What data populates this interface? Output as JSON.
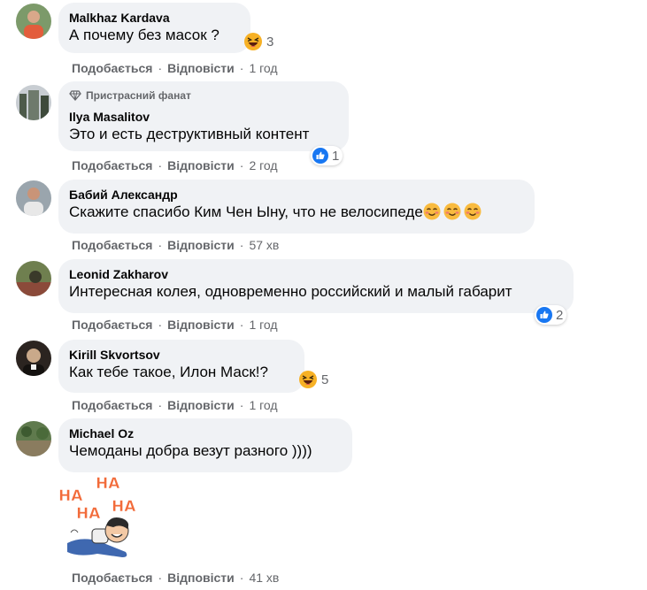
{
  "actions": {
    "like": "Подобається",
    "reply": "Відповісти"
  },
  "comments": [
    {
      "author": "Malkhaz Kardava",
      "text": "А почему без масок ?",
      "time": "1 год",
      "reactions": {
        "type": "haha",
        "count": "3"
      }
    },
    {
      "badge": "Пристрасний фанат",
      "author": "Ilya Masalitov",
      "text": "Это и есть деструктивный контент",
      "time": "2 год",
      "reactions": {
        "type": "like",
        "count": "1"
      }
    },
    {
      "author": "Бабий Александр",
      "text": "Скажите спасибо Ким Чен Ыну, что не велосипеде",
      "time": "57 хв",
      "emojis": [
        "blush",
        "blush",
        "blush"
      ]
    },
    {
      "author": "Leonid Zakharov",
      "text": "Интересная колея, одновременно российский и малый габарит",
      "time": "1 год",
      "reactions": {
        "type": "like",
        "count": "2"
      }
    },
    {
      "author": "Kirill Skvortsov",
      "text": "Как тебе такое, Илон Маск!?",
      "time": "1 год",
      "reactions": {
        "type": "haha",
        "count": "5"
      }
    },
    {
      "author": "Michael Oz",
      "text": "Чемоданы добра везут разного ))))",
      "time": "41 хв",
      "sticker": {
        "words": [
          "HA",
          "HA",
          "HA",
          "HA"
        ]
      }
    }
  ],
  "colors": {
    "bubble": "#f0f2f5",
    "meta": "#65676b",
    "like_blue": "#1877f2",
    "haha_yellow": "#f7b125"
  }
}
